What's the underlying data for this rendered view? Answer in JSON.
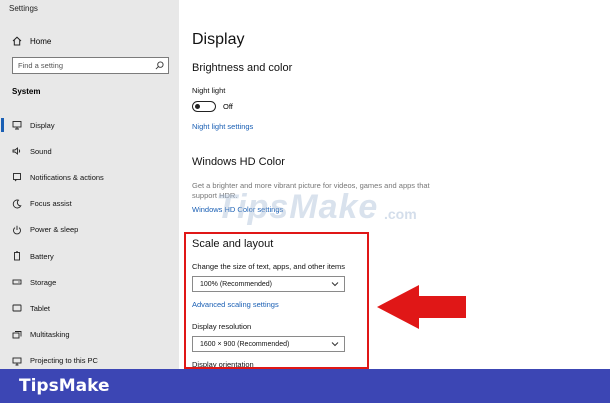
{
  "window": {
    "title": "Settings"
  },
  "sidebar": {
    "home_label": "Home",
    "search_placeholder": "Find a setting",
    "section_label": "System",
    "items": [
      {
        "label": "Display",
        "icon": "display-icon",
        "active": true
      },
      {
        "label": "Sound",
        "icon": "sound-icon"
      },
      {
        "label": "Notifications & actions",
        "icon": "notifications-icon"
      },
      {
        "label": "Focus assist",
        "icon": "moon-icon"
      },
      {
        "label": "Power & sleep",
        "icon": "power-icon"
      },
      {
        "label": "Battery",
        "icon": "battery-icon"
      },
      {
        "label": "Storage",
        "icon": "storage-icon"
      },
      {
        "label": "Tablet",
        "icon": "tablet-icon"
      },
      {
        "label": "Multitasking",
        "icon": "multitasking-icon"
      },
      {
        "label": "Projecting to this PC",
        "icon": "projecting-icon"
      }
    ]
  },
  "main": {
    "title": "Display",
    "brightness": {
      "heading": "Brightness and color",
      "night_light_label": "Night light",
      "toggle_state": "Off",
      "settings_link": "Night light settings"
    },
    "hd_color": {
      "heading": "Windows HD Color",
      "description": "Get a brighter and more vibrant picture for videos, games and apps that support HDR.",
      "settings_link": "Windows HD Color settings"
    },
    "scale": {
      "heading": "Scale and layout",
      "size_label": "Change the size of text, apps, and other items",
      "size_value": "100% (Recommended)",
      "advanced_link": "Advanced scaling settings",
      "resolution_label": "Display resolution",
      "resolution_value": "1600 × 900 (Recommended)",
      "orientation_label": "Display orientation"
    }
  },
  "overlay": {
    "watermark": "TipsMake",
    "watermark_tld": ".com",
    "brand": "TipsMake",
    "highlight_color": "#e01717",
    "bar_color": "#3c46b4"
  }
}
